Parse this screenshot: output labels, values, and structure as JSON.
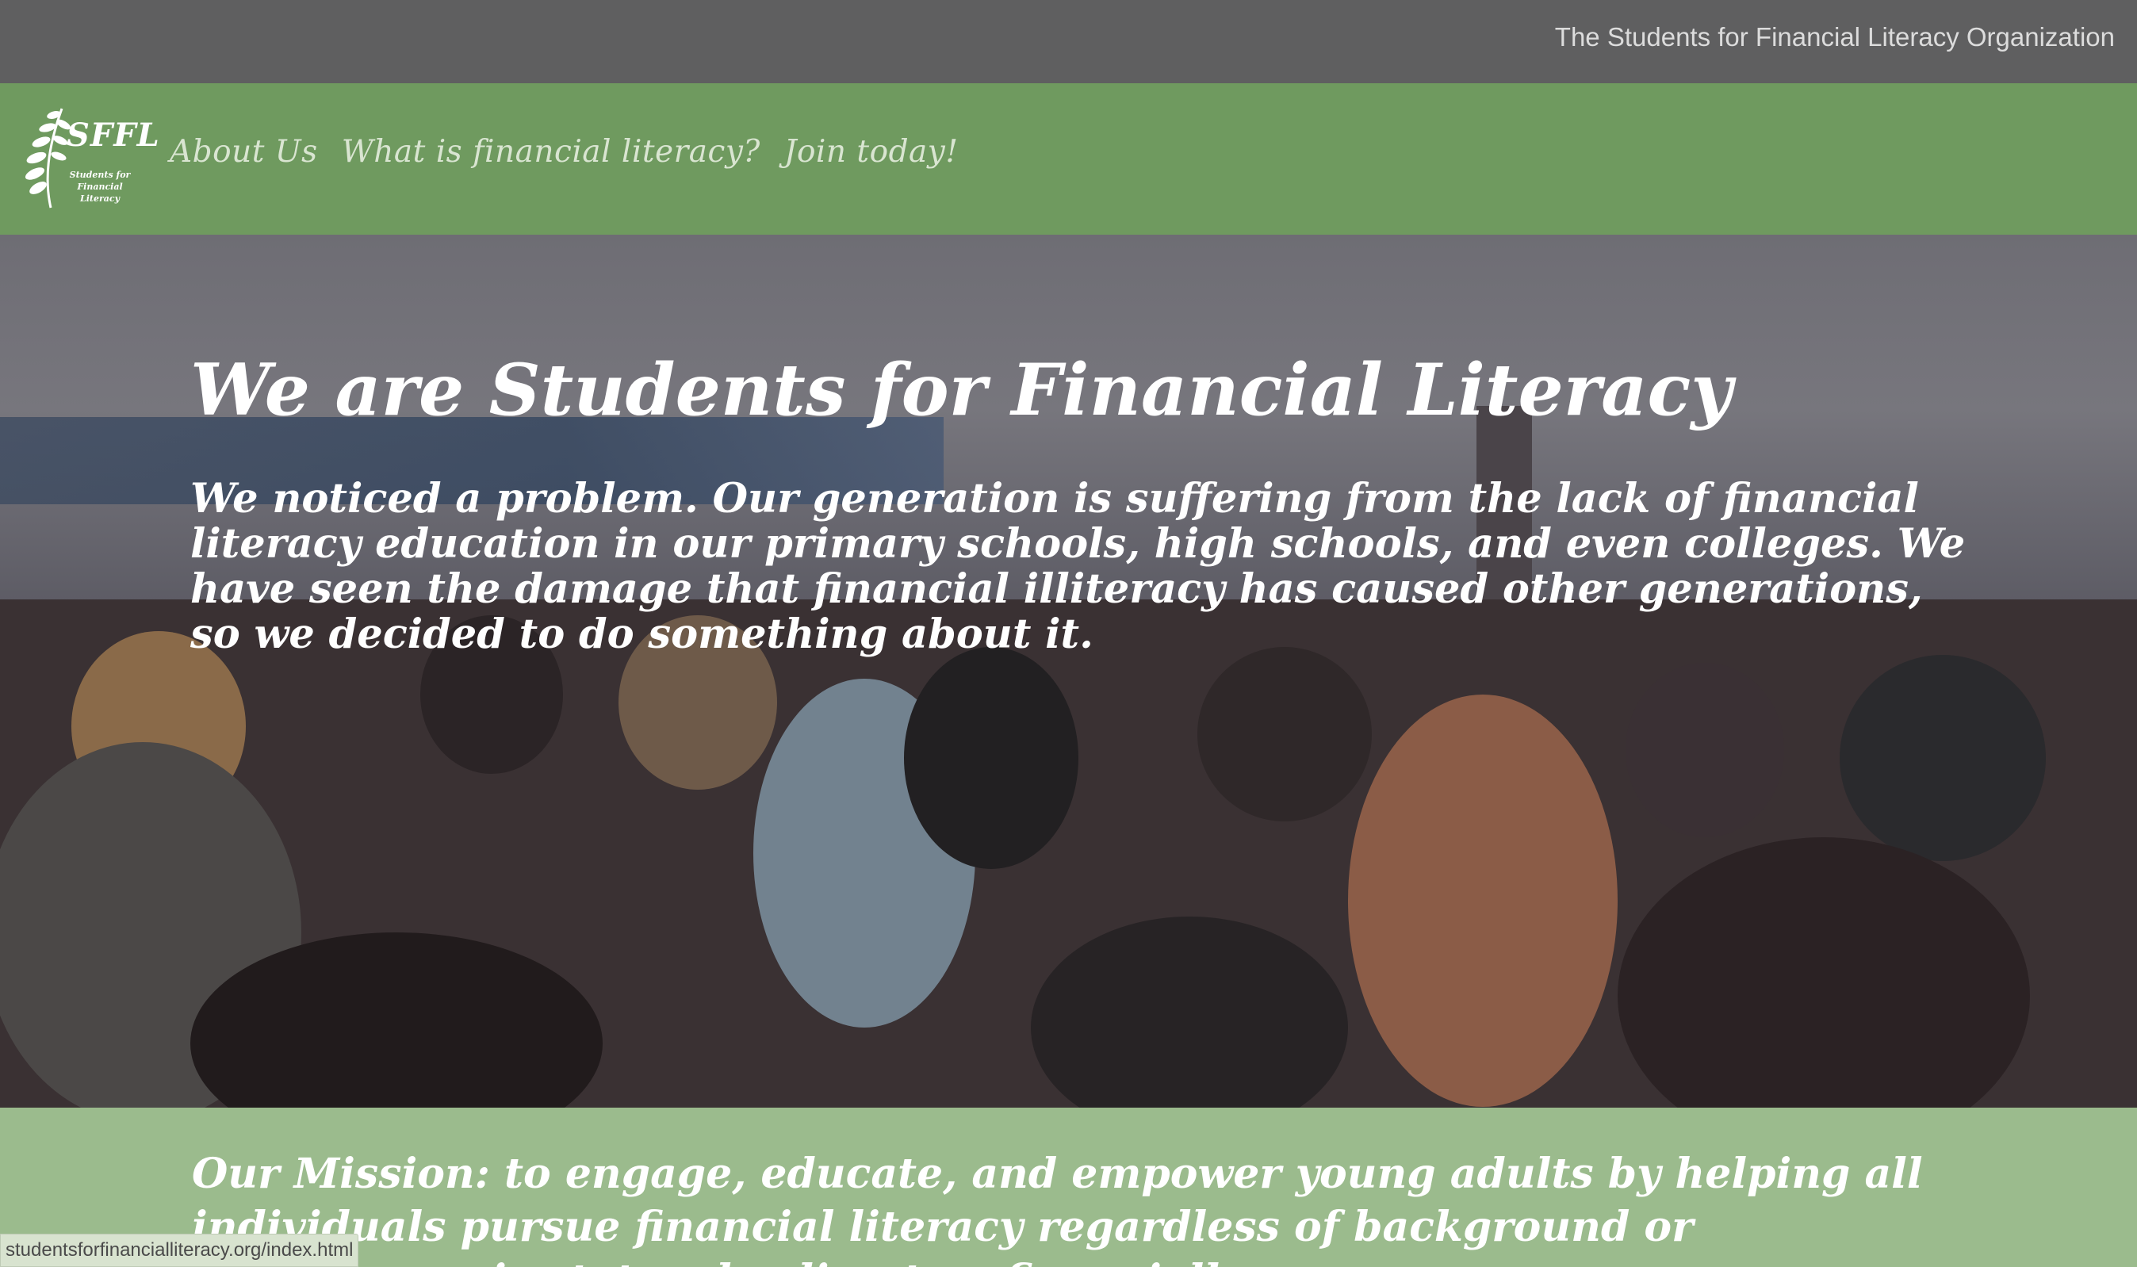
{
  "topbar": {
    "org_name": "The Students for Financial Literacy Organization"
  },
  "logo": {
    "main": "SFFL",
    "sub_line1": "Students for",
    "sub_line2": "Financial Literacy"
  },
  "nav": {
    "items": [
      {
        "label": "About Us"
      },
      {
        "label": "What is financial literacy?"
      },
      {
        "label": "Join today!"
      }
    ]
  },
  "hero": {
    "title": "We are Students for Financial Literacy",
    "body": "We noticed a problem. Our generation is suffering from the lack of financial literacy education in our primary schools, high schools, and even colleges. We have seen the damage that financial illiteracy has caused other generations, so we decided to do something about it."
  },
  "mission": {
    "text": "Our Mission: to engage, educate, and empower young adults by helping all individuals pursue financial literacy regardless of background or socioeconomic status, leading to a financially secure"
  },
  "status_bar": {
    "url": "studentsforfinancialliteracy.org/index.html"
  },
  "colors": {
    "topbar": "#5f5f60",
    "navbar": "#6f9a5f",
    "mission": "#9bbb8d",
    "nav_text": "#d9e5d1"
  }
}
